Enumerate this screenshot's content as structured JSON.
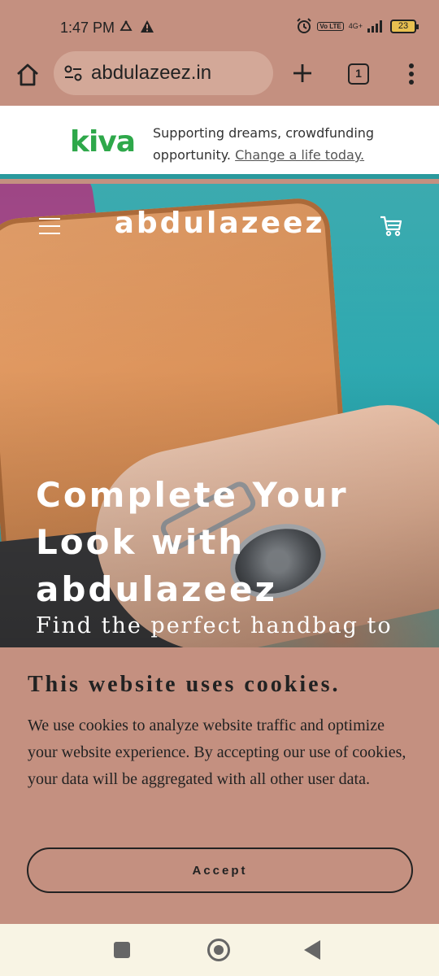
{
  "status_bar": {
    "time": "1:47 PM",
    "network": "4G+",
    "volte": "Vo LTE",
    "battery": "23"
  },
  "browser": {
    "url": "abdulazeez.in",
    "tab_count": "1"
  },
  "ad": {
    "brand": "kiva",
    "text": "Supporting dreams, crowdfunding opportunity.",
    "link": "Change a life today.",
    "colors": {
      "brand": "#2ea84a",
      "border": "#2a9a9e"
    }
  },
  "site": {
    "title": "abdulazeez",
    "hero_heading": "Complete Your Look with abdulazeez",
    "hero_sub": "Find the perfect handbag to"
  },
  "cookie": {
    "title": "This website uses cookies.",
    "body": "We use cookies to analyze website traffic and optimize your website experience. By accepting our use of cookies, your data will be aggregated with all other user data.",
    "accept_label": "Accept"
  },
  "colors": {
    "page_bg": "#c49080",
    "nav_bg": "#f8f4e4"
  }
}
